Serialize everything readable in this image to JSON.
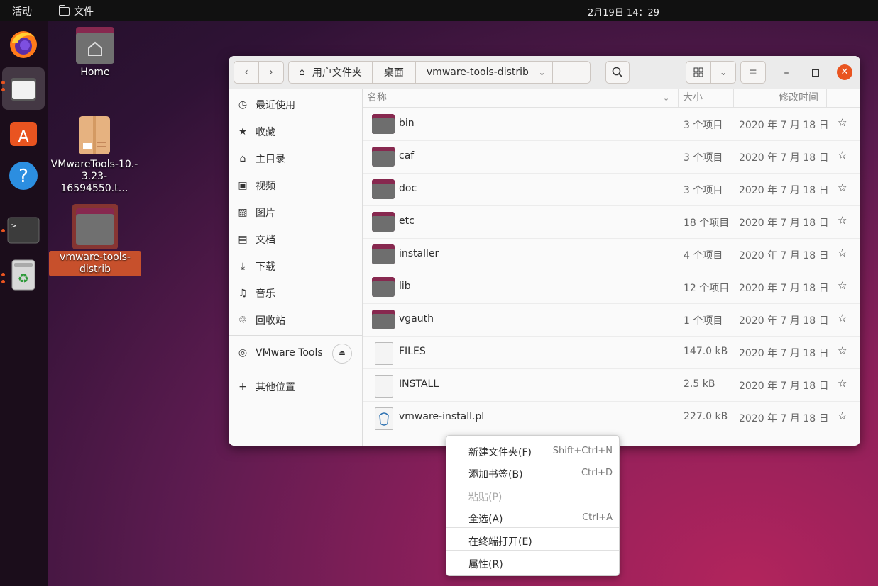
{
  "topbar": {
    "activities": "活动",
    "app_name": "文件",
    "clock": "2月19日  14：29"
  },
  "desktop": {
    "icons": [
      {
        "label": "Home"
      },
      {
        "label": "VMwareTools-10.-3.23-16594550.t…",
        "line1": "VMwareTools-10.-",
        "line2": "3.23-16594550.t…"
      },
      {
        "label": "vmware-tools-distrib",
        "line1": "vmware-tools-",
        "line2": "distrib"
      }
    ]
  },
  "window": {
    "breadcrumbs": [
      "用户文件夹",
      "桌面",
      "vmware-tools-distrib"
    ],
    "sidebar": [
      {
        "label": "最近使用",
        "icon": "clock-icon"
      },
      {
        "label": "收藏",
        "icon": "star-icon"
      },
      {
        "label": "主目录",
        "icon": "home-icon"
      },
      {
        "label": "视频",
        "icon": "video-icon"
      },
      {
        "label": "图片",
        "icon": "image-icon"
      },
      {
        "label": "文档",
        "icon": "document-icon"
      },
      {
        "label": "下载",
        "icon": "download-icon"
      },
      {
        "label": "音乐",
        "icon": "music-icon"
      },
      {
        "label": "回收站",
        "icon": "trash-icon"
      }
    ],
    "device": {
      "label": "VMware Tools"
    },
    "other_locations": "其他位置",
    "columns": {
      "name": "名称",
      "size": "大小",
      "modified": "修改时间"
    },
    "files": [
      {
        "name": "bin",
        "size": "3 个项目",
        "modified": "2020 年 7 月 18 日",
        "type": "folder"
      },
      {
        "name": "caf",
        "size": "3 个项目",
        "modified": "2020 年 7 月 18 日",
        "type": "folder"
      },
      {
        "name": "doc",
        "size": "3 个项目",
        "modified": "2020 年 7 月 18 日",
        "type": "folder"
      },
      {
        "name": "etc",
        "size": "18 个项目",
        "modified": "2020 年 7 月 18 日",
        "type": "folder"
      },
      {
        "name": "installer",
        "size": "4 个项目",
        "modified": "2020 年 7 月 18 日",
        "type": "folder"
      },
      {
        "name": "lib",
        "size": "12 个项目",
        "modified": "2020 年 7 月 18 日",
        "type": "folder"
      },
      {
        "name": "vgauth",
        "size": "1 个项目",
        "modified": "2020 年 7 月 18 日",
        "type": "folder"
      },
      {
        "name": "FILES",
        "size": "147.0 kB",
        "modified": "2020 年 7 月 18 日",
        "type": "text"
      },
      {
        "name": "INSTALL",
        "size": "2.5 kB",
        "modified": "2020 年 7 月 18 日",
        "type": "text"
      },
      {
        "name": "vmware-install.pl",
        "size": "227.0 kB",
        "modified": "2020 年 7 月 18 日",
        "type": "perl"
      }
    ]
  },
  "context_menu": {
    "items": [
      {
        "label": "新建文件夹(F)",
        "accel": "Shift+Ctrl+N",
        "enabled": true
      },
      {
        "label": "添加书签(B)",
        "accel": "Ctrl+D",
        "enabled": true
      },
      {
        "label": "粘贴(P)",
        "accel": "",
        "enabled": false
      },
      {
        "label": "全选(A)",
        "accel": "Ctrl+A",
        "enabled": true
      },
      {
        "label": "在终端打开(E)",
        "accel": "",
        "enabled": true
      },
      {
        "label": "属性(R)",
        "accel": "",
        "enabled": true
      }
    ]
  },
  "colors": {
    "accent": "#e95420",
    "close_button": "#e95420",
    "folder_tab": "#87284f",
    "folder_body": "#6e6e6e"
  }
}
